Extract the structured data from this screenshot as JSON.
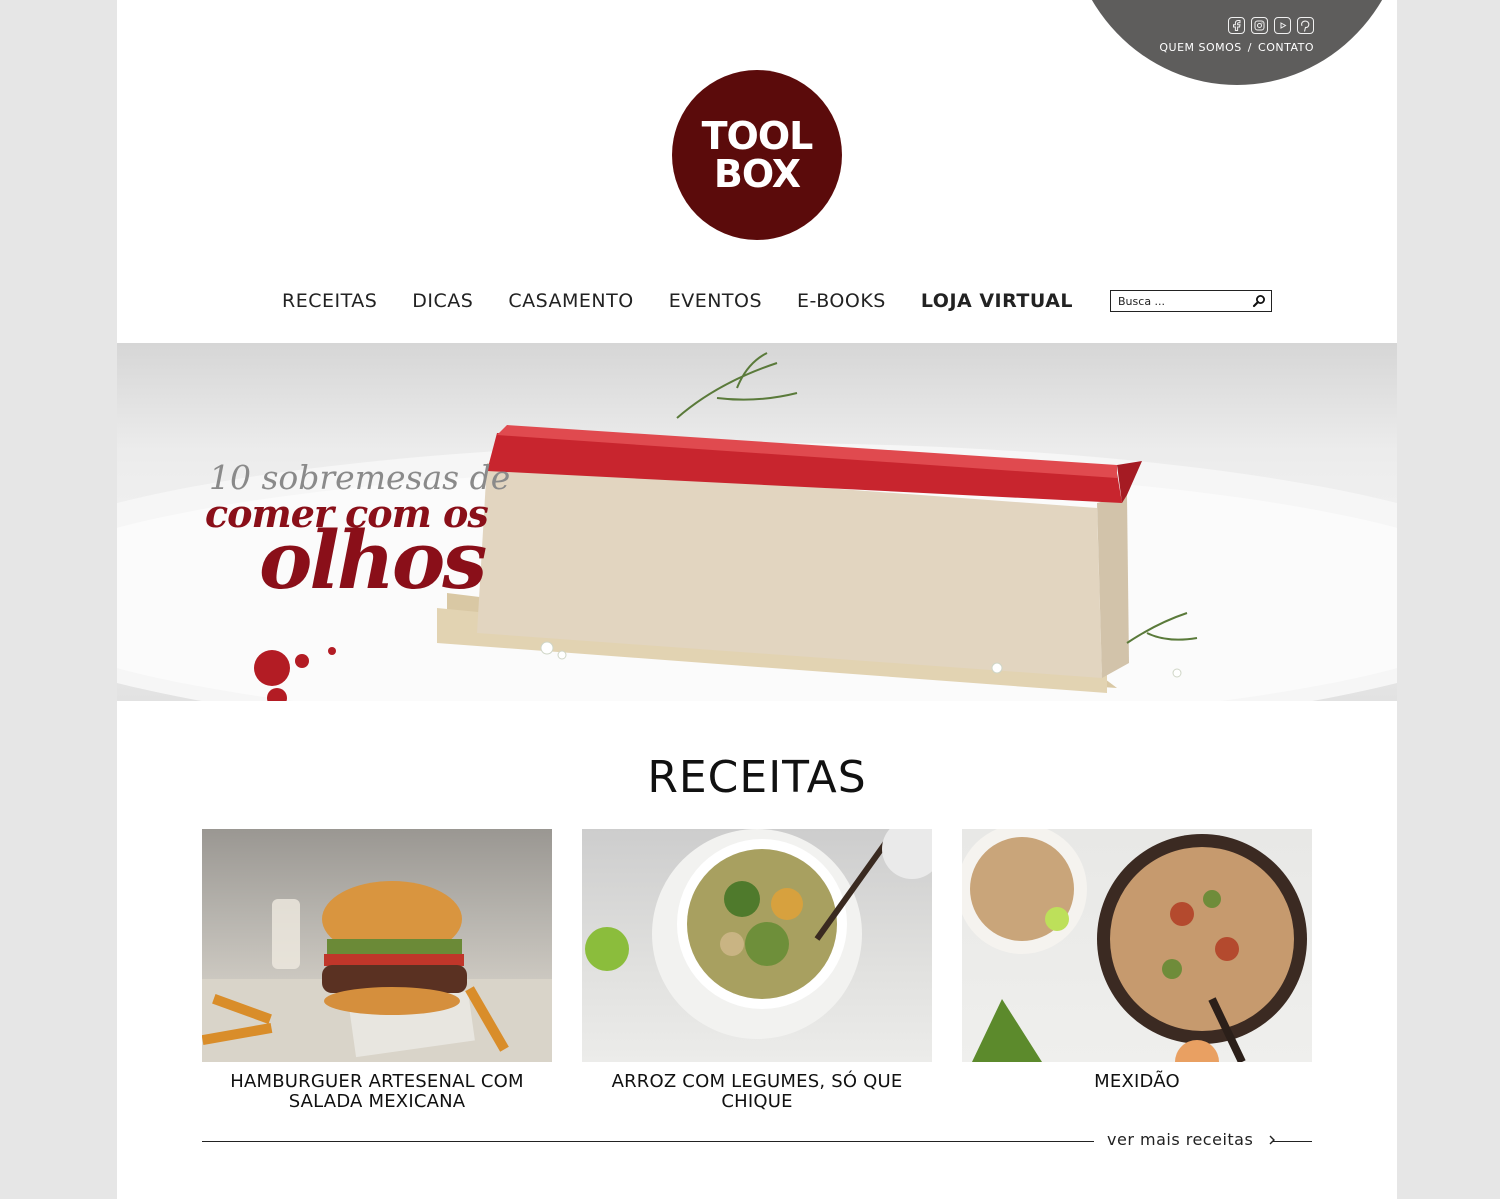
{
  "top": {
    "social_icons": [
      "facebook-icon",
      "instagram-icon",
      "youtube-icon",
      "pinterest-icon"
    ],
    "links": [
      "QUEM SOMOS",
      "/",
      "CONTATO"
    ]
  },
  "logo": {
    "line1": "TOOL",
    "line2": "BOX"
  },
  "nav": {
    "items": [
      "RECEITAS",
      "DICAS",
      "CASAMENTO",
      "EVENTOS",
      "E-BOOKS"
    ],
    "highlight": "LOJA VIRTUAL",
    "search_placeholder": "Busca ..."
  },
  "hero": {
    "line1": "10 sobremesas de",
    "line2": "comer com os",
    "line3": "olhos"
  },
  "receitas": {
    "title": "RECEITAS",
    "cards": [
      {
        "caption": "HAMBURGUER ARTESENAL COM SALADA MEXICANA"
      },
      {
        "caption": "ARROZ COM LEGUMES, SÓ QUE CHIQUE"
      },
      {
        "caption": "MEXIDÃO"
      }
    ],
    "more": "ver mais receitas"
  },
  "colors": {
    "brand": "#5b0b0b",
    "accent": "#8a0f19",
    "corner": "#5e5d5c",
    "background": "#e6e6e6"
  }
}
